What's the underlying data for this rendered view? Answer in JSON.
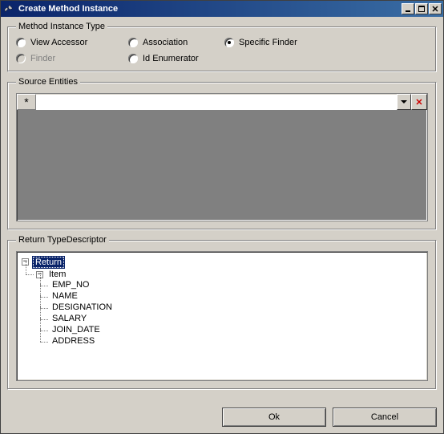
{
  "title": "Create Method Instance",
  "groups": {
    "method_instance_type": {
      "legend": "Method Instance Type",
      "options": {
        "view_accessor": "View Accessor",
        "association": "Association",
        "specific_finder": "Specific Finder",
        "finder": "Finder",
        "id_enumerator": "Id Enumerator"
      },
      "selected": "specific_finder",
      "disabled": [
        "finder"
      ]
    },
    "source_entities": {
      "legend": "Source Entities"
    },
    "return_type": {
      "legend": "Return TypeDescriptor",
      "tree": {
        "root": "Return",
        "item": "Item",
        "fields": [
          "EMP_NO",
          "NAME",
          "DESIGNATION",
          "SALARY",
          "JOIN_DATE",
          "ADDRESS"
        ]
      }
    }
  },
  "buttons": {
    "ok": "Ok",
    "cancel": "Cancel"
  },
  "icons": {
    "row_marker": "*",
    "delete": "✕",
    "collapse": "−"
  }
}
